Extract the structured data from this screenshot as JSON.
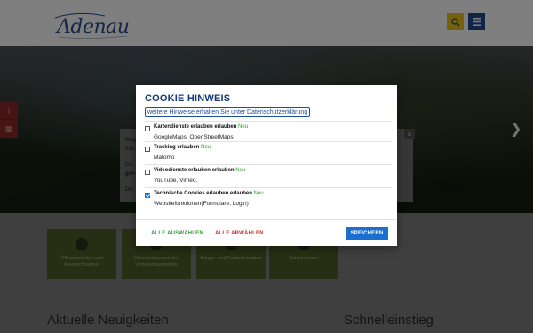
{
  "header": {
    "logo_text": "Adenau"
  },
  "hero": {
    "info_lines": [
      "Weg",
      "Info",
      "Die",
      "gan",
      "Die"
    ]
  },
  "tiles": [
    {
      "label": "Öffnungszeiten und Ansprechpartner"
    },
    {
      "label": "Dienstleistungen der Verbandsgemeinde"
    },
    {
      "label": "Bürger- und Ratsinformation"
    },
    {
      "label": "Bürgermelder"
    }
  ],
  "sections": {
    "news": "Aktuelle Neuigkeiten",
    "quick": "Schnelleinstieg"
  },
  "cookie": {
    "title": "COOKIE HINWEIS",
    "privacy_link": "weitere Hinweise erhalten Sie unter Datenschutzerklärung",
    "new_badge": "Neu",
    "options": [
      {
        "label": "Kartendienste erlauben erlauben",
        "desc": "GoogleMaps, OpenStreetMaps",
        "checked": false
      },
      {
        "label": "Tracking erlauben",
        "desc": "Matomo",
        "checked": false
      },
      {
        "label": "Videodienste erlauben erlauben",
        "desc": "YouTube, Vimeo.",
        "checked": false
      },
      {
        "label": "Technische Cookies erlauben erlauben",
        "desc": "Websitefunktionen(Formulare, Login)",
        "checked": true
      }
    ],
    "select_all": "ALLE AUSWÄHLEN",
    "deny_all": "ALLE ABWÄHLEN",
    "save": "SPEICHERN"
  },
  "colors": {
    "brand_blue": "#1f4a8a",
    "accent_yellow": "#e9c31a",
    "save_button": "#1a6fd1",
    "select_all_green": "#2f9e2f",
    "deny_all_red": "#d12b2b",
    "tile_olive": "#4d5c26"
  },
  "icons": {
    "search": "search-icon",
    "menu": "hamburger-menu-icon",
    "next": "chevron-right-icon"
  }
}
